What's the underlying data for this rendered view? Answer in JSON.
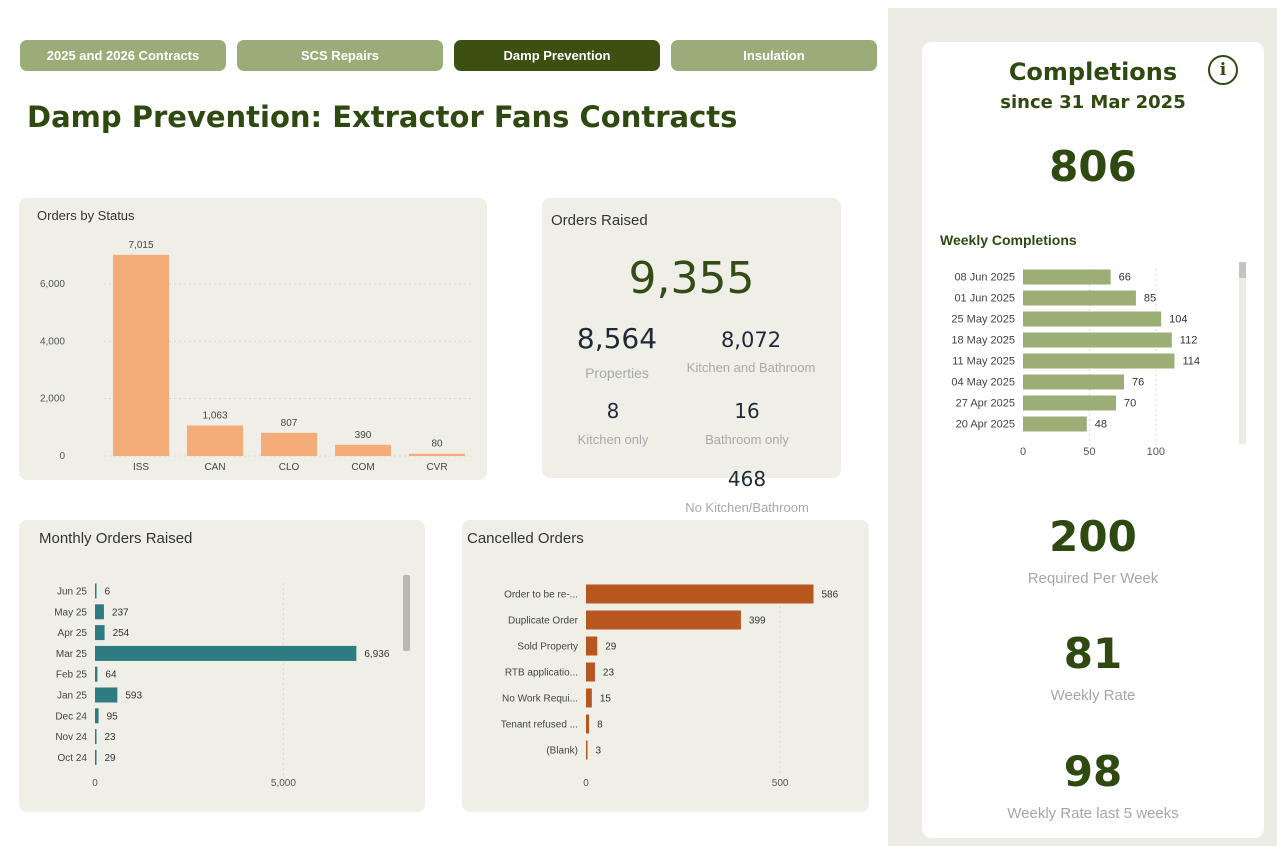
{
  "tabs": [
    {
      "label": "2025 and 2026 Contracts",
      "active": false
    },
    {
      "label": "SCS Repairs",
      "active": false
    },
    {
      "label": "Damp Prevention",
      "active": true
    },
    {
      "label": "Insulation",
      "active": false
    }
  ],
  "page_title": "Damp Prevention: Extractor Fans Contracts",
  "orders_raised": {
    "title": "Orders Raised",
    "total": "9,355",
    "properties": {
      "value": "8,564",
      "label": "Properties"
    },
    "kitchen_and_bathroom": {
      "value": "8,072",
      "label": "Kitchen and Bathroom"
    },
    "kitchen_only": {
      "value": "8",
      "label": "Kitchen only"
    },
    "bathroom_only": {
      "value": "16",
      "label": "Bathroom only"
    },
    "no_kitchen_bathroom": {
      "value": "468",
      "label": "No Kitchen/Bathroom"
    }
  },
  "completions": {
    "title": "Completions",
    "subtitle": "since 31 Mar 2025",
    "total": "806",
    "weekly_title": "Weekly Completions",
    "required": {
      "value": "200",
      "label": "Required Per Week"
    },
    "weekly_rate": {
      "value": "81",
      "label": "Weekly Rate"
    },
    "weekly_rate_5": {
      "value": "98",
      "label": "Weekly Rate last 5 weeks"
    },
    "info_icon": "info-icon"
  },
  "colors": {
    "status_bar": "#f4ad78",
    "monthly_bar": "#2e7b82",
    "cancelled_bar": "#b8561f",
    "weekly_bar": "#9aae76",
    "active_tab": "#3c5012",
    "tab": "#9cac78"
  },
  "chart_data": [
    {
      "id": "status",
      "type": "bar",
      "title": "Orders by Status",
      "categories": [
        "ISS",
        "CAN",
        "CLO",
        "COM",
        "CVR"
      ],
      "values": [
        7015,
        1063,
        807,
        390,
        80
      ],
      "labels": [
        "7,015",
        "1,063",
        "807",
        "390",
        "80"
      ],
      "yticks": [
        0,
        2000,
        4000,
        6000
      ],
      "ytick_labels": [
        "0",
        "2,000",
        "4,000",
        "6,000"
      ],
      "ylim": [
        0,
        7600
      ],
      "grid": true
    },
    {
      "id": "monthly",
      "type": "bar",
      "orientation": "horizontal",
      "title": "Monthly Orders Raised",
      "categories": [
        "Jun 25",
        "May 25",
        "Apr 25",
        "Mar 25",
        "Feb 25",
        "Jan 25",
        "Dec 24",
        "Nov 24",
        "Oct 24"
      ],
      "values": [
        6,
        237,
        254,
        6936,
        64,
        593,
        95,
        23,
        29
      ],
      "labels": [
        "6",
        "237",
        "254",
        "6,936",
        "64",
        "593",
        "95",
        "23",
        "29"
      ],
      "xticks": [
        0,
        5000
      ],
      "xtick_labels": [
        "0",
        "5,000"
      ],
      "xlim": [
        0,
        8200
      ],
      "grid": true
    },
    {
      "id": "cancelled",
      "type": "bar",
      "orientation": "horizontal",
      "title": "Cancelled Orders",
      "categories": [
        "Order to be re-...",
        "Duplicate Order",
        "Sold Property",
        "RTB applicatio...",
        "No Work Requi...",
        "Tenant refused ...",
        "(Blank)"
      ],
      "values": [
        586,
        399,
        29,
        23,
        15,
        8,
        3
      ],
      "labels": [
        "586",
        "399",
        "29",
        "23",
        "15",
        "8",
        "3"
      ],
      "xticks": [
        0,
        500
      ],
      "xtick_labels": [
        "0",
        "500"
      ],
      "xlim": [
        0,
        680
      ],
      "grid": true
    },
    {
      "id": "weekly",
      "type": "bar",
      "orientation": "horizontal",
      "title": "Weekly Completions",
      "categories": [
        "08 Jun 2025",
        "01 Jun 2025",
        "25 May 2025",
        "18 May 2025",
        "11 May 2025",
        "04 May 2025",
        "27 Apr 2025",
        "20 Apr 2025"
      ],
      "values": [
        66,
        85,
        104,
        112,
        114,
        76,
        70,
        48
      ],
      "labels": [
        "66",
        "85",
        "104",
        "112",
        "114",
        "76",
        "70",
        "48"
      ],
      "xticks": [
        0,
        50,
        100
      ],
      "xtick_labels": [
        "0",
        "50",
        "100"
      ],
      "xlim": [
        0,
        140
      ],
      "grid": true
    }
  ]
}
